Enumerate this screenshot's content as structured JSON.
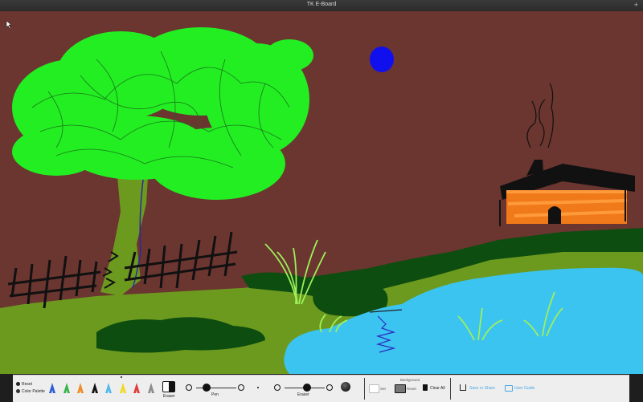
{
  "window": {
    "title": "TK E-Board",
    "add_icon": "+"
  },
  "canvas": {
    "background": "#6b3530"
  },
  "toolbar": {
    "reset_label": "Reset",
    "color_palette_label": "Color Palette",
    "pens": [
      {
        "name": "blue-pen",
        "color": "#2f5fd6"
      },
      {
        "name": "green-pen",
        "color": "#37b54a"
      },
      {
        "name": "orange-pen",
        "color": "#f08a24"
      },
      {
        "name": "black-pen",
        "color": "#111111"
      },
      {
        "name": "lightblue-pen",
        "color": "#54b8ee"
      },
      {
        "name": "yellow-pen",
        "color": "#f2d81e"
      },
      {
        "name": "red-pen",
        "color": "#e23b3b"
      },
      {
        "name": "gray-pen",
        "color": "#8c8c8c"
      }
    ],
    "eraser_label": "Eraser",
    "pen_label": "Pen",
    "pen_size": 0.25,
    "eraser_size_label": "Eraser",
    "eraser_size": 0.55,
    "background_label": "Background",
    "set_label": "Set",
    "reset_bg_label": "Reset",
    "clear_all_label": "Clear All",
    "save_share_label": "Save or Share",
    "user_guide_label": "User Guide",
    "accent_color": "#4aa8e8"
  }
}
